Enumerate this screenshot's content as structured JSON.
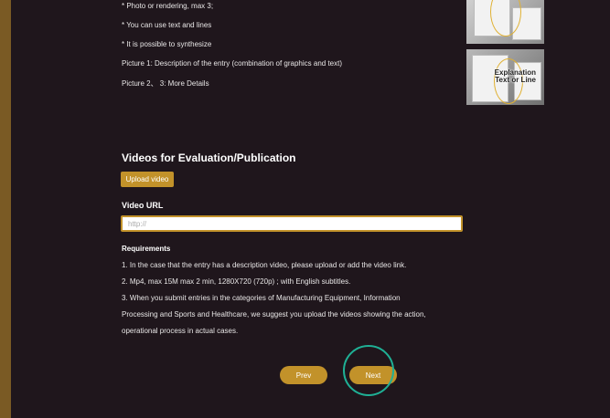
{
  "guidelines": [
    "* Photo or rendering, max 3;",
    "* You can use text and lines",
    "* It is possible to synthesize",
    "Picture 1: Description of the entry (combination of graphics and text)",
    "Picture 2、 3: More Details"
  ],
  "example_image": {
    "text_line1": "Explanation",
    "text_line2": "Text or Line"
  },
  "videos": {
    "title": "Videos for Evaluation/Publication",
    "upload_label": "Upload video",
    "url_label": "Video URL",
    "url_placeholder": "http://",
    "url_value": ""
  },
  "requirements": {
    "title": "Requirements",
    "lines": [
      "1. In the case that the entry has a description video, please upload or add the video link.",
      "2. Mp4, max 15M max 2 min, 1280X720 (720p) ; with English subtitles.",
      "3. When you submit entries in the categories of Manufacturing Equipment, Information",
      "Processing and Sports and Healthcare, we suggest you upload the videos showing the action,",
      "operational process in actual cases."
    ]
  },
  "navigation": {
    "prev_label": "Prev",
    "next_label": "Next"
  },
  "colors": {
    "background": "#1f161c",
    "border_gold": "#7a5a24",
    "button_gold": "#c2922a",
    "highlight_teal": "#1fb095"
  }
}
